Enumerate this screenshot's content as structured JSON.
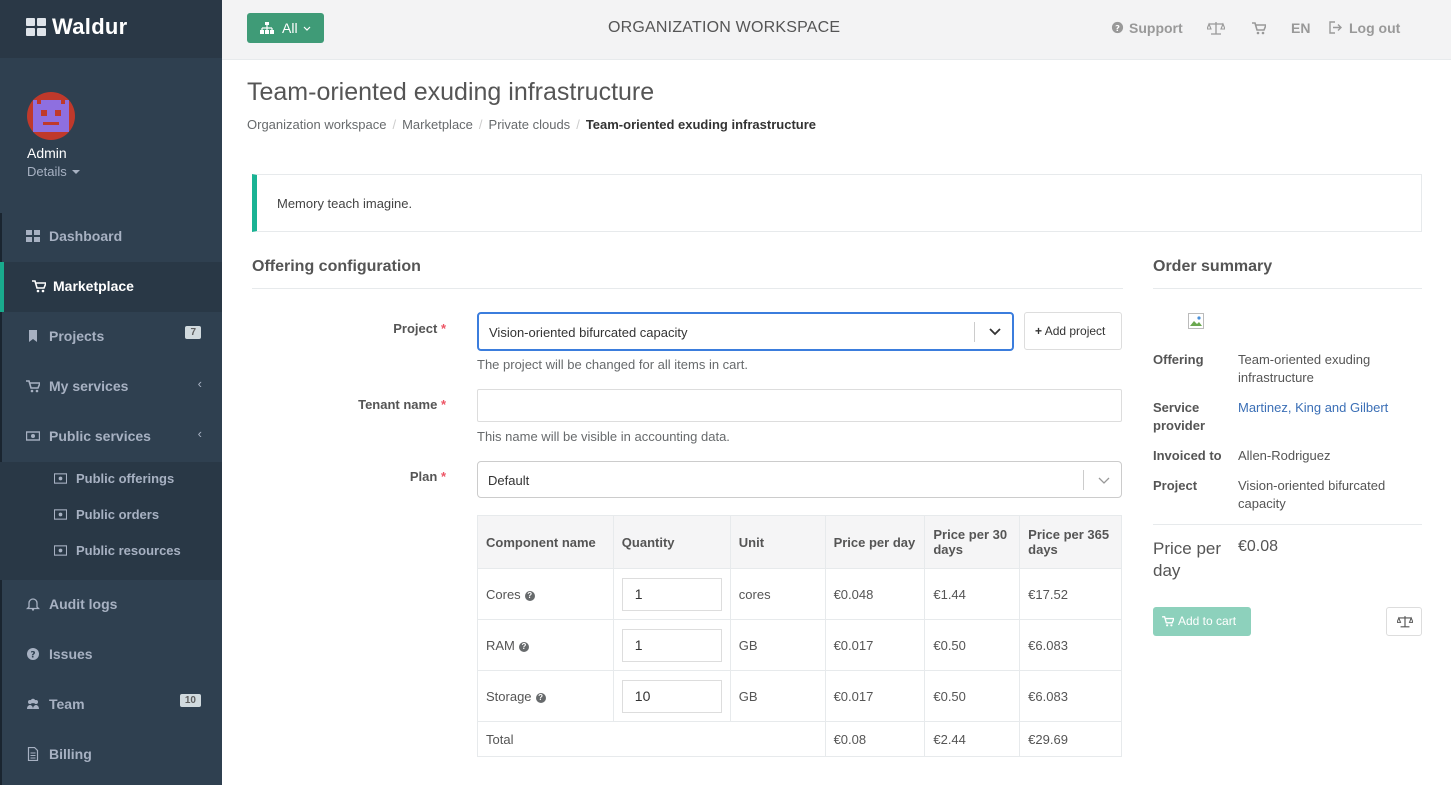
{
  "app": {
    "brand": "Waldur"
  },
  "profile": {
    "name": "Admin",
    "details_label": "Details"
  },
  "sidebar": {
    "items": [
      {
        "label": "Dashboard",
        "icon": "dashboard-icon"
      },
      {
        "label": "Marketplace",
        "icon": "cart-icon",
        "active": true
      },
      {
        "label": "Projects",
        "icon": "bookmark-icon",
        "badge": "7"
      },
      {
        "label": "My services",
        "icon": "cart-icon",
        "arrow": "‹"
      },
      {
        "label": "Public services",
        "icon": "money-icon",
        "arrow": "‹"
      },
      {
        "label": "Audit logs",
        "icon": "bell-icon"
      },
      {
        "label": "Issues",
        "icon": "question-icon"
      },
      {
        "label": "Team",
        "icon": "users-icon",
        "badge": "10"
      },
      {
        "label": "Billing",
        "icon": "file-icon"
      }
    ],
    "subitems": [
      {
        "label": "Public offerings"
      },
      {
        "label": "Public orders"
      },
      {
        "label": "Public resources"
      }
    ]
  },
  "topbar": {
    "filter_label": "All",
    "title": "ORGANIZATION WORKSPACE",
    "support": "Support",
    "language": "EN",
    "logout": "Log out"
  },
  "page": {
    "title": "Team-oriented exuding infrastructure",
    "breadcrumb": [
      "Organization workspace",
      "Marketplace",
      "Private clouds",
      "Team-oriented exuding infrastructure"
    ],
    "alert": "Memory teach imagine."
  },
  "config": {
    "title": "Offering configuration",
    "project_label": "Project",
    "project_value": "Vision-oriented bifurcated capacity",
    "add_project": "Add project",
    "project_help": "The project will be changed for all items in cart.",
    "tenant_label": "Tenant name",
    "tenant_value": "",
    "tenant_help": "This name will be visible in accounting data.",
    "plan_label": "Plan",
    "plan_value": "Default",
    "required_mark": "*"
  },
  "components": {
    "headers": [
      "Component name",
      "Quantity",
      "Unit",
      "Price per day",
      "Price per 30 days",
      "Price per 365 days"
    ],
    "rows": [
      {
        "name": "Cores",
        "qty": "1",
        "unit": "cores",
        "day": "€0.048",
        "m30": "€1.44",
        "y365": "€17.52"
      },
      {
        "name": "RAM",
        "qty": "1",
        "unit": "GB",
        "day": "€0.017",
        "m30": "€0.50",
        "y365": "€6.083"
      },
      {
        "name": "Storage",
        "qty": "10",
        "unit": "GB",
        "day": "€0.017",
        "m30": "€0.50",
        "y365": "€6.083"
      }
    ],
    "total": {
      "label": "Total",
      "day": "€0.08",
      "m30": "€2.44",
      "y365": "€29.69"
    }
  },
  "summary": {
    "title": "Order summary",
    "offering_label": "Offering",
    "offering_value": "Team-oriented exuding infrastructure",
    "provider_label": "Service provider",
    "provider_value": "Martinez, King and Gilbert",
    "invoiced_label": "Invoiced to",
    "invoiced_value": "Allen-Rodriguez",
    "project_label": "Project",
    "project_value": "Vision-oriented bifurcated capacity",
    "price_label": "Price per day",
    "price_value": "€0.08",
    "add_to_cart": "Add to cart"
  },
  "colors": {
    "sidebar": "#2f4050",
    "accent": "#1ab394",
    "primary_button": "#3f9b77",
    "link": "#3b6fb6",
    "focus": "#3b7ddd"
  }
}
